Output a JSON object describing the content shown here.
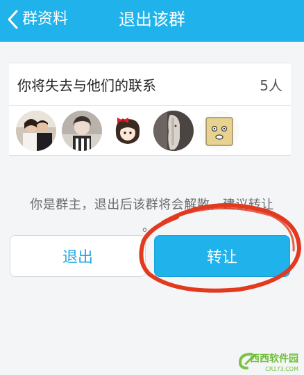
{
  "header": {
    "back_label": "群资料",
    "title": "退出该群"
  },
  "members": {
    "label": "你将失去与他们的联系",
    "count": "5人",
    "avatars": [
      "avatar-couple",
      "avatar-girl-bw",
      "avatar-cartoon-girl",
      "avatar-horse",
      "avatar-box-face"
    ]
  },
  "notice": {
    "text": "你是群主，退出后该群将会解散，建议转让",
    "tail": "。"
  },
  "actions": {
    "quit_label": "退出",
    "transfer_label": "转让"
  },
  "colors": {
    "accent": "#1fb2eb",
    "annotation": "#e23a1f"
  },
  "watermark": {
    "brand": "西西软件园",
    "sub": "CR173.COM"
  }
}
